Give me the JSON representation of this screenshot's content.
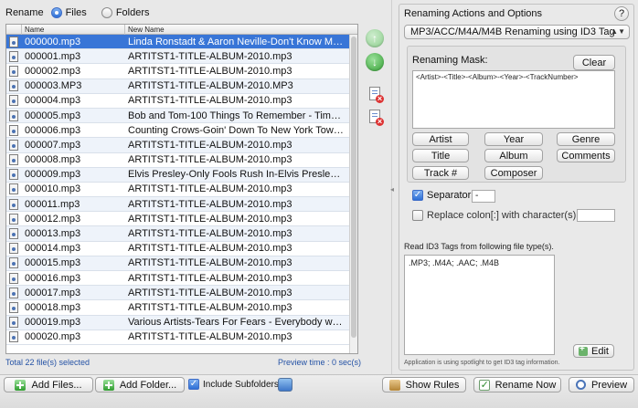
{
  "header": {
    "rename_label": "Rename",
    "files_label": "Files",
    "folders_label": "Folders"
  },
  "table": {
    "columns": [
      "Name",
      "New Name"
    ],
    "rows": [
      {
        "name": "000000.mp3",
        "new_name": "Linda Ronstadt & Aaron Neville-Don't Know Mu…"
      },
      {
        "name": "000001.mp3",
        "new_name": "ARTITST1-TITLE-ALBUM-2010.mp3"
      },
      {
        "name": "000002.mp3",
        "new_name": "ARTITST1-TITLE-ALBUM-2010.mp3"
      },
      {
        "name": "000003.MP3",
        "new_name": "ARTITST1-TITLE-ALBUM-2010.MP3"
      },
      {
        "name": "000004.mp3",
        "new_name": "ARTITST1-TITLE-ALBUM-2010.mp3"
      },
      {
        "name": "000005.mp3",
        "new_name": "Bob and Tom-100 Things To Remember - Tim…"
      },
      {
        "name": "000006.mp3",
        "new_name": "Counting Crows-Goin' Down To New York Town…"
      },
      {
        "name": "000007.mp3",
        "new_name": "ARTITST1-TITLE-ALBUM-2010.mp3"
      },
      {
        "name": "000008.mp3",
        "new_name": "ARTITST1-TITLE-ALBUM-2010.mp3"
      },
      {
        "name": "000009.mp3",
        "new_name": "Elvis Presley-Only Fools Rush In-Elvis Presley Lo…"
      },
      {
        "name": "000010.mp3",
        "new_name": "ARTITST1-TITLE-ALBUM-2010.mp3"
      },
      {
        "name": "000011.mp3",
        "new_name": "ARTITST1-TITLE-ALBUM-2010.mp3"
      },
      {
        "name": "000012.mp3",
        "new_name": "ARTITST1-TITLE-ALBUM-2010.mp3"
      },
      {
        "name": "000013.mp3",
        "new_name": "ARTITST1-TITLE-ALBUM-2010.mp3"
      },
      {
        "name": "000014.mp3",
        "new_name": "ARTITST1-TITLE-ALBUM-2010.mp3"
      },
      {
        "name": "000015.mp3",
        "new_name": "ARTITST1-TITLE-ALBUM-2010.mp3"
      },
      {
        "name": "000016.mp3",
        "new_name": "ARTITST1-TITLE-ALBUM-2010.mp3"
      },
      {
        "name": "000017.mp3",
        "new_name": "ARTITST1-TITLE-ALBUM-2010.mp3"
      },
      {
        "name": "000018.mp3",
        "new_name": "ARTITST1-TITLE-ALBUM-2010.mp3"
      },
      {
        "name": "000019.mp3",
        "new_name": "Various Artists-Tears For Fears - Everybody wa…"
      },
      {
        "name": "000020.mp3",
        "new_name": "ARTITST1-TITLE-ALBUM-2010.mp3"
      }
    ]
  },
  "status": {
    "total": "Total 22 file(s) selected",
    "preview_time": "Preview time : 0 sec(s)"
  },
  "panel": {
    "title": "Renaming Actions and Options",
    "help": "?",
    "mode": "MP3/ACC/M4A/M4B Renaming using ID3 Tag",
    "mask_label": "Renaming Mask:",
    "clear": "Clear",
    "mask_text": "<Artist>-<Title>-<Album>-<Year>-<TrackNumber>",
    "tag_buttons": {
      "artist": "Artist",
      "year": "Year",
      "genre": "Genre",
      "title": "Title",
      "album": "Album",
      "comments": "Comments",
      "track": "Track #",
      "composer": "Composer"
    },
    "separator_label": "Separator",
    "separator_value": "-",
    "colon_label": "Replace colon[:] with character(s)",
    "read_label": "Read ID3 Tags from following file type(s).",
    "file_types": ".MP3; .M4A; .AAC; .M4B",
    "edit": "Edit",
    "spotlight_note": "Application is using spotlight to get ID3 tag information."
  },
  "bottom": {
    "add_files": "Add Files...",
    "add_folder": "Add Folder...",
    "include_subfolders": "Include Subfolders",
    "show_rules": "Show Rules",
    "rename_now": "Rename Now",
    "preview": "Preview"
  }
}
